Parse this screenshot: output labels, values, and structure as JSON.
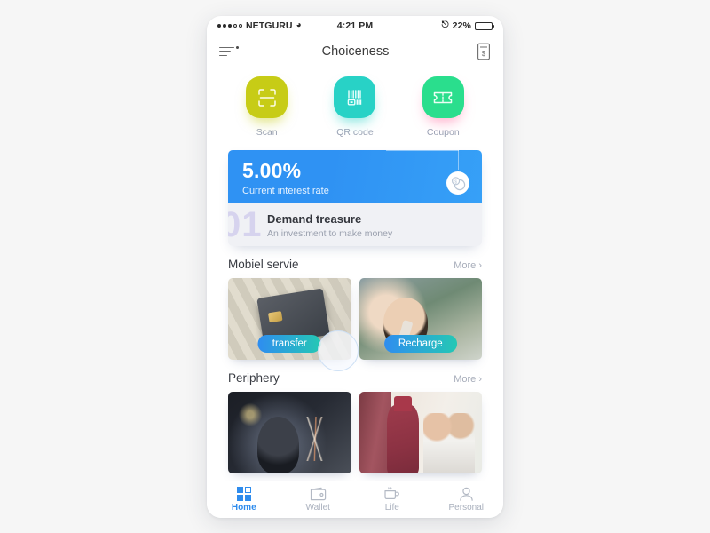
{
  "status_bar": {
    "carrier": "NETGURU",
    "signal_dots_filled": 3,
    "signal_dots_total": 5,
    "wifi_icon": "wifi-icon",
    "time": "4:21 PM",
    "bluetooth_icon": "bluetooth-icon",
    "battery_percent": "22%",
    "battery_level": 22
  },
  "navbar": {
    "menu_icon": "hamburger-menu-icon",
    "title": "Choiceness",
    "receipt_icon": "receipt-dollar-icon"
  },
  "quick_actions": [
    {
      "label": "Scan",
      "icon": "scan-frame-icon",
      "color": "#c7cc16",
      "glow": "#c7cc16"
    },
    {
      "label": "QR code",
      "icon": "barcode-icon",
      "color": "#28d2c6",
      "glow": "#28d2c6"
    },
    {
      "label": "Coupon",
      "icon": "ticket-icon",
      "color": "#2ade8d",
      "glow": "#ff6ea0"
    }
  ],
  "banner": {
    "rate": "5.00%",
    "rate_label": "Current interest rate",
    "coin_icon": "coin-dollar-icon",
    "watermark": "01",
    "title": "Demand treasure",
    "description": "An investment to make money",
    "accent": "#2f92f3"
  },
  "sections": [
    {
      "title": "Mobiel servie",
      "more_label": "More ›",
      "cards": [
        {
          "pill": "transfer",
          "image": "credit-card-and-cash-photo"
        },
        {
          "pill": "Recharge",
          "image": "man-on-phone-great-wall-photo"
        }
      ]
    },
    {
      "title": "Periphery",
      "more_label": "More ›",
      "cards": [
        {
          "pill": "",
          "image": "night-concert-person-photo"
        },
        {
          "pill": "",
          "image": "hotel-bellhop-guests-photo"
        }
      ]
    }
  ],
  "tabbar": {
    "active_color": "#2f8ced",
    "inactive_color": "#a9b0bd",
    "items": [
      {
        "label": "Home",
        "icon": "grid-icon",
        "active": true
      },
      {
        "label": "Wallet",
        "icon": "wallet-icon",
        "active": false
      },
      {
        "label": "Life",
        "icon": "cup-icon",
        "active": false
      },
      {
        "label": "Personal",
        "icon": "person-icon",
        "active": false
      }
    ]
  }
}
